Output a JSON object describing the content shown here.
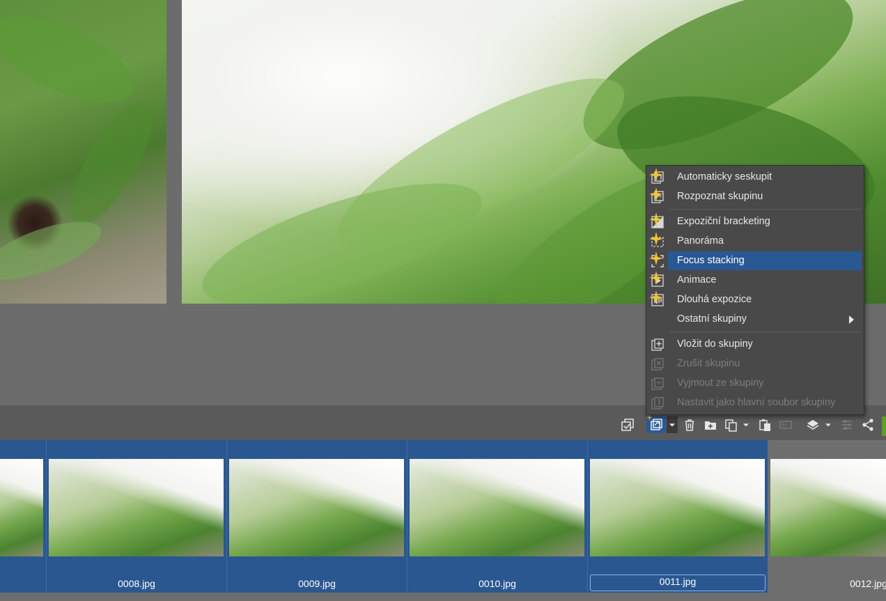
{
  "menu": {
    "items": [
      {
        "label": "Automaticky seskupit",
        "icon": "auto-group-icon",
        "enabled": true
      },
      {
        "label": "Rozpoznat skupinu",
        "icon": "recognize-group-icon",
        "enabled": true
      },
      {
        "label": "Expoziční bracketing",
        "icon": "exposure-bracketing-icon",
        "enabled": true
      },
      {
        "label": "Panoráma",
        "icon": "panorama-icon",
        "enabled": true
      },
      {
        "label": "Focus stacking",
        "icon": "focus-stacking-icon",
        "enabled": true,
        "highlighted": true
      },
      {
        "label": "Animace",
        "icon": "animation-icon",
        "enabled": true
      },
      {
        "label": "Dlouhá expozice",
        "icon": "long-exposure-icon",
        "enabled": true
      },
      {
        "label": "Ostatní skupiny",
        "icon": "",
        "enabled": true,
        "submenu": true
      },
      {
        "label": "Vložit do skupiny",
        "icon": "insert-into-group-icon",
        "enabled": true
      },
      {
        "label": "Zrušit skupinu",
        "icon": "cancel-group-icon",
        "enabled": false
      },
      {
        "label": "Vyjmout ze skupiny",
        "icon": "remove-from-group-icon",
        "enabled": false
      },
      {
        "label": "Nastavit jako hlavní soubor skupiny",
        "icon": "set-main-file-icon",
        "enabled": false
      }
    ]
  },
  "toolbar": {
    "buttons": [
      "select-check-icon",
      "group-icon",
      "dropdown-icon",
      "trash-icon",
      "new-folder-icon",
      "copy-icon",
      "dropdown-icon",
      "paste-icon",
      "rename-icon",
      "layers-icon",
      "dropdown-icon",
      "adjust-icon",
      "share-icon"
    ]
  },
  "filmstrip": {
    "thumbnails": [
      {
        "filename": "",
        "selected": true
      },
      {
        "filename": "0008.jpg",
        "selected": true
      },
      {
        "filename": "0009.jpg",
        "selected": true
      },
      {
        "filename": "0010.jpg",
        "selected": true
      },
      {
        "filename": "0011.jpg",
        "selected": true,
        "focused": true
      },
      {
        "filename": "0012.jpg",
        "selected": false
      }
    ]
  },
  "colors": {
    "accent": "#295893",
    "selection": "#2a5790",
    "menu_bg": "#494949",
    "toolbar_bg": "#5a5a5a",
    "sparkle": "#f4c430"
  }
}
